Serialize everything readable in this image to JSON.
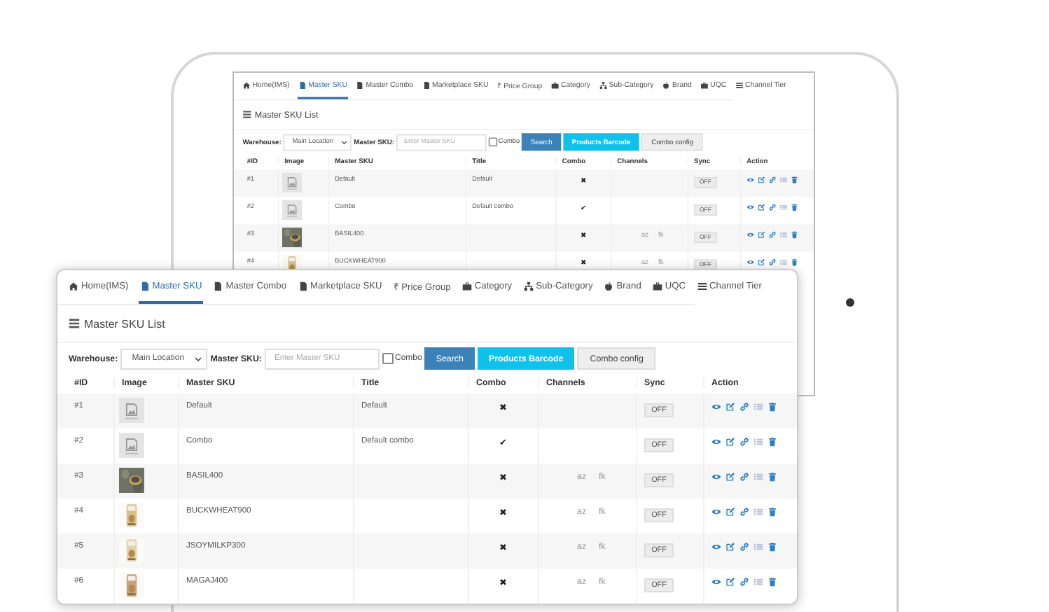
{
  "tablet_screen": {
    "nav": [
      {
        "label": "Home(IMS)",
        "selected": false
      },
      {
        "label": "Master SKU",
        "selected": true
      },
      {
        "label": "Master Combo",
        "selected": false
      },
      {
        "label": "Marketplace SKU",
        "selected": false
      },
      {
        "label": "₹ Price Group",
        "selected": false
      },
      {
        "label": "Category",
        "selected": false
      },
      {
        "label": "Sub-Category",
        "selected": false
      },
      {
        "label": "Brand",
        "selected": false
      },
      {
        "label": "UQC",
        "selected": false
      },
      {
        "label": "Channel Tier",
        "selected": false
      }
    ],
    "title": "Master SKU List",
    "toolbar": {
      "warehouse_label": "Warehouse:",
      "warehouse_select": "Main Location",
      "sku_label": "Master SKU:",
      "sku_input": {
        "placeholder": "Enter Master SKU"
      },
      "combo_checkbox": {
        "label": "Combo",
        "checked": false
      },
      "buttons": [
        {
          "label": "Search",
          "kind": "primary"
        },
        {
          "label": "Products Barcode",
          "kind": "info"
        },
        {
          "label": "Combo config",
          "kind": "default"
        }
      ]
    },
    "columns": [
      "#ID",
      "Image",
      "Master SKU",
      "Title",
      "Combo",
      "Channels",
      "Sync",
      "Action"
    ],
    "rows": [
      {
        "id": "#1",
        "image": {
          "kind": "placeholder"
        },
        "master_sku": "Default",
        "title": "Default",
        "combo": "✖",
        "channels": [],
        "sync": "OFF"
      },
      {
        "id": "#2",
        "image": {
          "kind": "placeholder"
        },
        "master_sku": "Combo",
        "title": "Default combo",
        "combo": "✔",
        "channels": [],
        "sync": "OFF"
      },
      {
        "id": "#3",
        "image": {
          "kind": "picture"
        },
        "master_sku": "BASIL400",
        "combo": "✖",
        "channels": [
          "az",
          "fk"
        ],
        "sync": "OFF"
      },
      {
        "id": "#4",
        "image": {
          "kind": "picture"
        },
        "master_sku": "BUCKWHEAT900",
        "combo": "✖",
        "channels": [
          "az",
          "fk"
        ],
        "sync": "OFF"
      }
    ]
  },
  "front_window": {
    "nav": [
      {
        "label": "Home(IMS)",
        "selected": false
      },
      {
        "label": "Master SKU",
        "selected": true
      },
      {
        "label": "Master Combo",
        "selected": false
      },
      {
        "label": "Marketplace SKU",
        "selected": false
      },
      {
        "label": "₹ Price Group",
        "selected": false
      },
      {
        "label": "Category",
        "selected": false
      },
      {
        "label": "Sub-Category",
        "selected": false
      },
      {
        "label": "Brand",
        "selected": false
      },
      {
        "label": "UQC",
        "selected": false
      },
      {
        "label": "Channel Tier",
        "selected": false
      }
    ],
    "title": "Master SKU List",
    "toolbar": {
      "warehouse_label": "Warehouse:",
      "warehouse_select": "Main Location",
      "sku_label": "Master SKU:",
      "sku_input": {
        "placeholder": "Enter Master SKU"
      },
      "combo_checkbox": {
        "label": "Combo",
        "checked": false
      },
      "buttons": [
        {
          "label": "Search",
          "kind": "primary"
        },
        {
          "label": "Products Barcode",
          "kind": "info"
        },
        {
          "label": "Combo config",
          "kind": "default"
        }
      ]
    },
    "columns": [
      "#ID",
      "Image",
      "Master SKU",
      "Title",
      "Combo",
      "Channels",
      "Sync",
      "Action"
    ],
    "rows": [
      {
        "id": "#1",
        "image": {
          "kind": "placeholder"
        },
        "master_sku": "Default",
        "title": "Default",
        "combo": "✖",
        "channels": [],
        "sync": "OFF"
      },
      {
        "id": "#2",
        "image": {
          "kind": "placeholder"
        },
        "master_sku": "Combo",
        "title": "Default combo",
        "combo": "✔",
        "channels": [],
        "sync": "OFF"
      },
      {
        "id": "#3",
        "image": {
          "kind": "picture"
        },
        "master_sku": "BASIL400",
        "combo": "✖",
        "channels": [
          "az",
          "fk"
        ],
        "sync": "OFF"
      },
      {
        "id": "#4",
        "image": {
          "kind": "picture"
        },
        "master_sku": "BUCKWHEAT900",
        "combo": "✖",
        "channels": [
          "az",
          "fk"
        ],
        "sync": "OFF"
      },
      {
        "id": "#5",
        "image": {
          "kind": "picture"
        },
        "master_sku": "JSOYMILKP300",
        "combo": "✖",
        "channels": [
          "az",
          "fk"
        ],
        "sync": "OFF"
      },
      {
        "id": "#6",
        "image": {
          "kind": "picture"
        },
        "master_sku": "MAGAJ400",
        "combo": "✖",
        "channels": [
          "az",
          "fk"
        ],
        "sync": "OFF"
      }
    ]
  }
}
